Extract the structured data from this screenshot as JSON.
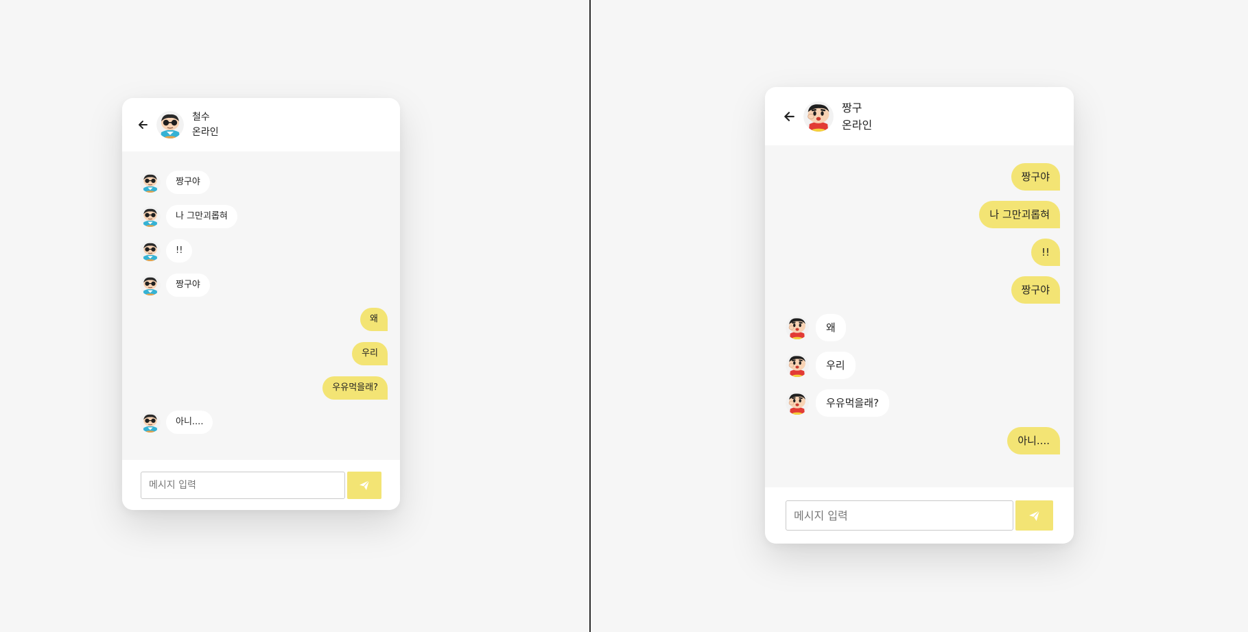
{
  "colors": {
    "accent": "#f3e474",
    "background": "#f6f6f6",
    "card": "#ffffff"
  },
  "panels": [
    {
      "header": {
        "back_icon": "arrow-left-icon",
        "name": "철수",
        "status": "온라인",
        "avatar": "cheolsu-avatar"
      },
      "messages": [
        {
          "from": "other",
          "text": "짱구야"
        },
        {
          "from": "other",
          "text": "나 그만괴롭혀"
        },
        {
          "from": "other",
          "text": "!!"
        },
        {
          "from": "other",
          "text": "짱구야"
        },
        {
          "from": "me",
          "text": "왜"
        },
        {
          "from": "me",
          "text": "우리"
        },
        {
          "from": "me",
          "text": "우유먹을래?"
        },
        {
          "from": "other",
          "text": "아니...."
        }
      ],
      "composer": {
        "placeholder": "메시지 입력",
        "send_icon": "paper-plane-icon"
      }
    },
    {
      "header": {
        "back_icon": "arrow-left-icon",
        "name": "짱구",
        "status": "온라인",
        "avatar": "jjanggu-avatar"
      },
      "messages": [
        {
          "from": "me",
          "text": "짱구야"
        },
        {
          "from": "me",
          "text": "나 그만괴롭혀"
        },
        {
          "from": "me",
          "text": "!!"
        },
        {
          "from": "me",
          "text": "짱구야"
        },
        {
          "from": "other",
          "text": "왜"
        },
        {
          "from": "other",
          "text": "우리"
        },
        {
          "from": "other",
          "text": "우유먹을래?"
        },
        {
          "from": "me",
          "text": "아니...."
        }
      ],
      "composer": {
        "placeholder": "메시지 입력",
        "send_icon": "paper-plane-icon"
      }
    }
  ]
}
